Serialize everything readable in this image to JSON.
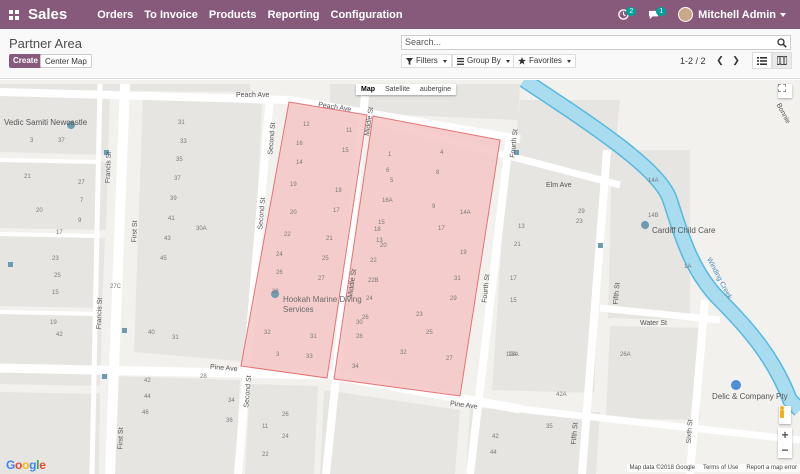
{
  "app": {
    "title": "Sales"
  },
  "nav": [
    "Orders",
    "To Invoice",
    "Products",
    "Reporting",
    "Configuration"
  ],
  "systray": {
    "activity_count": "2",
    "message_count": "1",
    "user": "Mitchell Admin"
  },
  "control_panel": {
    "breadcrumb": "Partner Area",
    "create_label": "Create",
    "center_map_label": "Center Map",
    "search_placeholder": "Search...",
    "filters_label": "Filters",
    "group_by_label": "Group By",
    "favorites_label": "Favorites",
    "pager": "1-2 / 2"
  },
  "map": {
    "map_types": [
      "Map",
      "Satellite",
      "aubergine"
    ],
    "active_map_type": "Map",
    "zoom_in": "+",
    "zoom_out": "−",
    "attribution": {
      "data": "Map data ©2018 Google",
      "terms": "Terms of Use",
      "report": "Report a map error"
    },
    "google_logo": "Google",
    "colors": {
      "area_fill": "#f5c6c6",
      "area_stroke": "#e57373",
      "water": "#a9dcef",
      "water_edge": "#55b9e0",
      "road": "#ffffff",
      "block": "#e6e5e2",
      "poi": "#6e9bb0"
    },
    "streets": [
      "Peach Ave",
      "Peach Ave",
      "Elm Ave",
      "Water St",
      "Pine Ave",
      "Pine Ave",
      "Second St",
      "Second St",
      "Second St",
      "Middle St",
      "Middle St",
      "First St",
      "First St",
      "Francis St",
      "Francis St",
      "Fourth St",
      "Fourth St",
      "Fifth St",
      "Fifth St",
      "Sixth St",
      "Winding Creek",
      "Bonnie"
    ],
    "places": [
      "Vedic Samiti Newcastle",
      "Hookah Marine Diving Services",
      "Cardiff Child Care",
      "Delic & Company Pty"
    ],
    "house_numbers": [
      "12",
      "11",
      "16",
      "15",
      "14",
      "19",
      "18",
      "17",
      "20",
      "22",
      "21",
      "24",
      "26",
      "25",
      "28",
      "27",
      "32",
      "31",
      "3",
      "33",
      "1",
      "4",
      "6",
      "5",
      "8",
      "16A",
      "9",
      "15",
      "13",
      "18",
      "17",
      "20",
      "14A",
      "22",
      "22B",
      "19",
      "24",
      "23",
      "26",
      "25",
      "28",
      "27",
      "30",
      "32",
      "29",
      "31",
      "34",
      "14A",
      "14B",
      "29",
      "23",
      "13",
      "21",
      "19A",
      "15",
      "17",
      "31",
      "33",
      "35",
      "37",
      "39",
      "41",
      "43",
      "45",
      "40",
      "42",
      "44",
      "46",
      "27C",
      "30A",
      "31",
      "28",
      "34",
      "36",
      "18A",
      "26A",
      "35",
      "42A",
      "42",
      "44",
      "21",
      "1A",
      "3",
      "37",
      "20",
      "15",
      "42",
      "19",
      "17",
      "23",
      "25",
      "27",
      "7",
      "9",
      "11",
      "26",
      "24",
      "22",
      "16"
    ]
  }
}
